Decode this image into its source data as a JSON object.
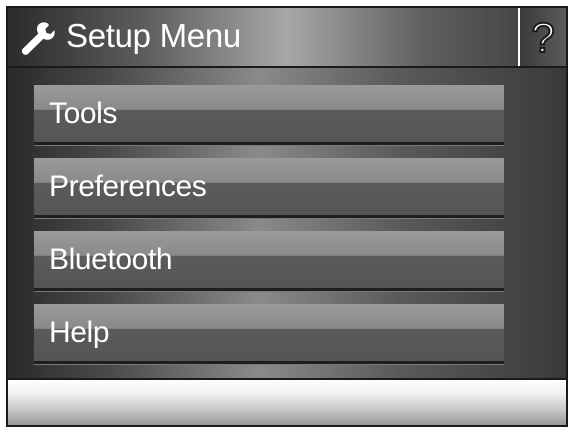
{
  "header": {
    "title": "Setup Menu",
    "title_icon": "wrench-icon",
    "help_icon": "question-mark-icon",
    "help_glyph": "?"
  },
  "menu": {
    "items": [
      {
        "label": "Tools"
      },
      {
        "label": "Preferences"
      },
      {
        "label": "Bluetooth"
      },
      {
        "label": "Help"
      }
    ]
  }
}
